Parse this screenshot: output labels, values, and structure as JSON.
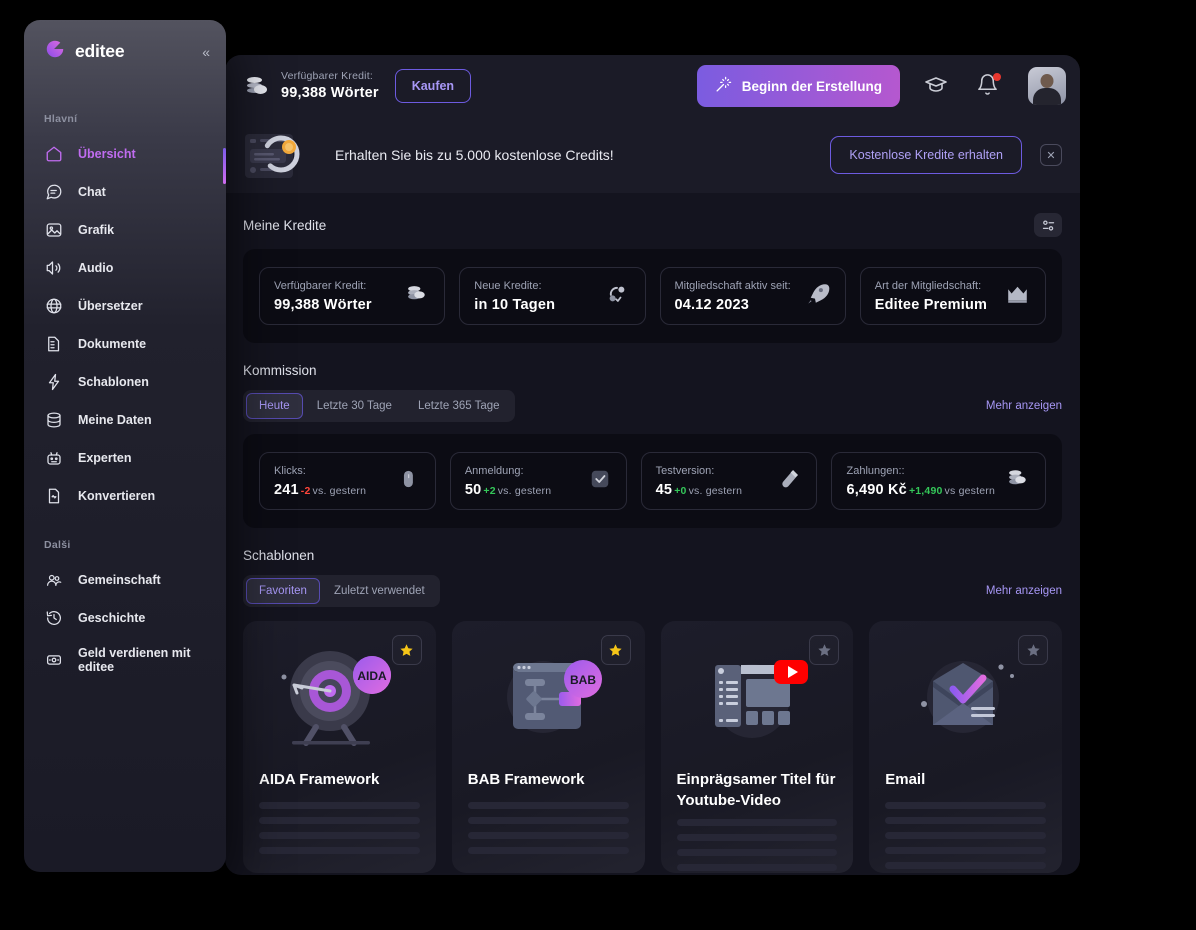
{
  "sidebar": {
    "brand": "editee",
    "collapse_icon": "chevrons-left-icon",
    "groups": [
      {
        "label": "Hlavní",
        "items": [
          {
            "label": "Übersicht",
            "icon": "home-icon",
            "active": true
          },
          {
            "label": "Chat",
            "icon": "chat-bubble-icon",
            "active": false
          },
          {
            "label": "Grafik",
            "icon": "image-icon",
            "active": false
          },
          {
            "label": "Audio",
            "icon": "speaker-icon",
            "active": false
          },
          {
            "label": "Übersetzer",
            "icon": "globe-icon",
            "active": false
          },
          {
            "label": "Dokumente",
            "icon": "document-icon",
            "active": false
          },
          {
            "label": "Schablonen",
            "icon": "lightning-bolt-icon",
            "active": false
          },
          {
            "label": "Meine Daten",
            "icon": "database-icon",
            "active": false
          },
          {
            "label": "Experten",
            "icon": "robot-icon",
            "active": false
          },
          {
            "label": "Konvertieren",
            "icon": "file-convert-icon",
            "active": false
          }
        ]
      },
      {
        "label": "Dalši",
        "items": [
          {
            "label": "Gemeinschaft",
            "icon": "people-icon",
            "active": false
          },
          {
            "label": "Geschichte",
            "icon": "history-clock-icon",
            "active": false
          },
          {
            "label": "Geld verdienen mit editee",
            "icon": "money-box-icon",
            "active": false
          }
        ]
      }
    ]
  },
  "topbar": {
    "credit_icon": "coins-icon",
    "credit_label": "Verfügbarer Kredit:",
    "credit_value": "99,388 Wörter",
    "buy_button": "Kaufen",
    "create_button": "Beginn der Erstellung",
    "create_icon": "magic-wand-icon",
    "academy_icon": "graduation-cap-icon",
    "notifications_icon": "bell-icon",
    "avatar_icon": "user-avatar"
  },
  "banner": {
    "art_icon": "credits-illustration",
    "text": "Erhalten Sie bis zu 5.000 kostenlose Credits!",
    "cta": "Kostenlose Kredite erhalten",
    "close_icon": "close-icon"
  },
  "credits_section": {
    "title": "Meine Kredite",
    "settings_icon": "sliders-icon",
    "cards": [
      {
        "label": "Verfügbarer Kredit:",
        "value": "99,388 Wörter",
        "icon": "coins-icon"
      },
      {
        "label": "Neue Kredite:",
        "value": "in 10 Tagen",
        "icon": "refresh-cycle-icon"
      },
      {
        "label": "Mitgliedschaft aktiv seit:",
        "value": "04.12 2023",
        "icon": "rocket-icon"
      },
      {
        "label": "Art der Mitgliedschaft:",
        "value": "Editee Premium",
        "icon": "crown-icon"
      }
    ]
  },
  "commission_section": {
    "title": "Kommission",
    "tabs": [
      {
        "label": "Heute",
        "active": true
      },
      {
        "label": "Letzte 30 Tage",
        "active": false
      },
      {
        "label": "Letzte 365 Tage",
        "active": false
      }
    ],
    "more_link": "Mehr anzeigen",
    "cards": [
      {
        "label": "Klicks:",
        "value": "241",
        "delta": "-2",
        "delta_dir": "down",
        "vs": "vs. gestern",
        "icon": "mouse-icon"
      },
      {
        "label": "Anmeldung:",
        "value": "50",
        "delta": "+2",
        "delta_dir": "up",
        "vs": "vs. gestern",
        "icon": "checkbox-icon"
      },
      {
        "label": "Testversion:",
        "value": "45",
        "delta": "+0",
        "delta_dir": "up",
        "vs": "vs. gestern",
        "icon": "test-tube-icon"
      },
      {
        "label": "Zahlungen::",
        "value": "6,490 Kč",
        "delta": "+1,490",
        "delta_dir": "up",
        "vs": "vs gestern",
        "icon": "coins-icon"
      }
    ]
  },
  "templates_section": {
    "title": "Schablonen",
    "tabs": [
      {
        "label": "Favoriten",
        "active": true
      },
      {
        "label": "Zuletzt verwendet",
        "active": false
      }
    ],
    "more_link": "Mehr anzeigen",
    "cards": [
      {
        "title": "AIDA Framework",
        "badge": "AIDA",
        "art": "target-dart-icon",
        "starred": true,
        "star_icon": "star-icon"
      },
      {
        "title": "BAB Framework",
        "badge": "BAB",
        "art": "flow-diagram-icon",
        "starred": true,
        "star_icon": "star-icon"
      },
      {
        "title": "Einprägsamer Titel für Youtube-Video",
        "badge": "",
        "art": "youtube-page-icon",
        "starred": false,
        "star_icon": "star-icon"
      },
      {
        "title": "Email",
        "badge": "",
        "art": "email-check-icon",
        "starred": false,
        "star_icon": "star-icon"
      }
    ]
  },
  "colors": {
    "accent_purple": "#a797f5",
    "accent_pink": "#c06cf0",
    "positive": "#34c759",
    "negative": "#ff453a",
    "panel_bg": "#14141f",
    "card_bg": "#0c0c14",
    "star_gold": "#f5c518"
  }
}
